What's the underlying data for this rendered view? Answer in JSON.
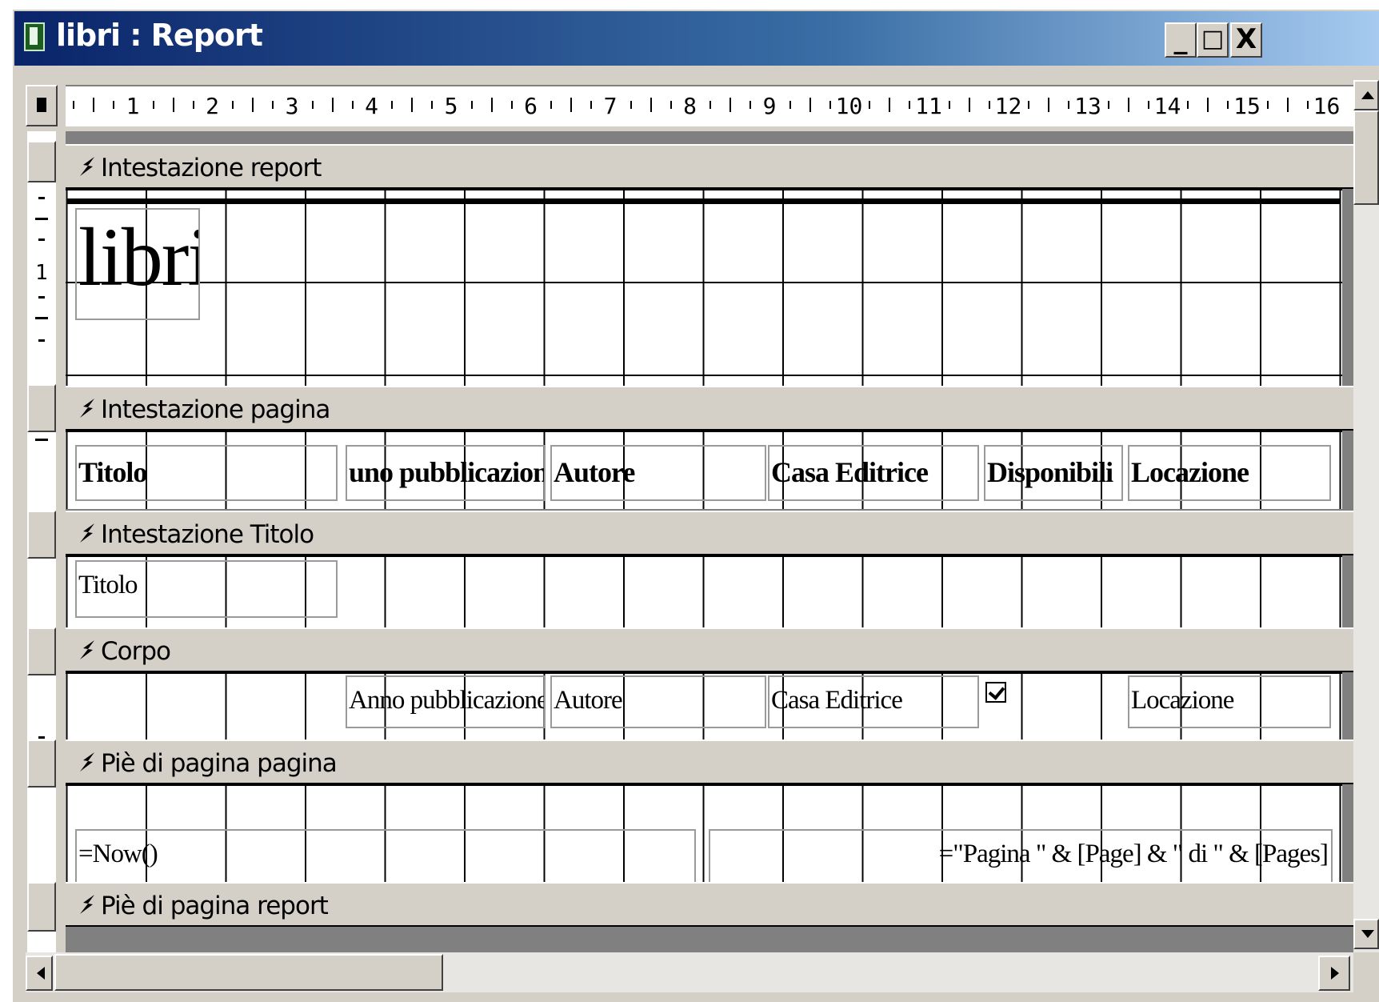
{
  "window": {
    "title": "libri : Report",
    "controls": {
      "minimize": "_",
      "maximize": "□",
      "close": "X"
    }
  },
  "ruler": {
    "numbers": [
      "1",
      "2",
      "3",
      "4",
      "5",
      "6",
      "7",
      "8",
      "9",
      "10",
      "11",
      "12",
      "13",
      "14",
      "15",
      "16"
    ]
  },
  "vertical_ruler": {
    "marks": [
      "1"
    ]
  },
  "sections": [
    {
      "label": "Intestazione report"
    },
    {
      "label": "Intestazione pagina"
    },
    {
      "label": "Intestazione Titolo"
    },
    {
      "label": "Corpo"
    },
    {
      "label": "Piè di pagina pagina"
    },
    {
      "label": "Piè di pagina report"
    }
  ],
  "report_header": {
    "title_label": "libri"
  },
  "page_header": {
    "labels": [
      "Titolo",
      "uno pubblicazione",
      "Autore",
      "Casa Editrice",
      "Disponibili",
      "Locazione"
    ]
  },
  "title_header": {
    "field": "Titolo"
  },
  "detail": {
    "fields": [
      "Anno pubblicazione",
      "Autore",
      "Casa Editrice",
      "Locazione"
    ],
    "checkbox_checked": true
  },
  "page_footer": {
    "date_expr": "=Now()",
    "page_expr": "=\"Pagina \" & [Page] & \" di \" & [Pages]"
  },
  "icons": [
    "report-icon",
    "section-arrow-icon",
    "scroll-up-icon",
    "scroll-down-icon",
    "scroll-left-icon",
    "scroll-right-icon"
  ]
}
